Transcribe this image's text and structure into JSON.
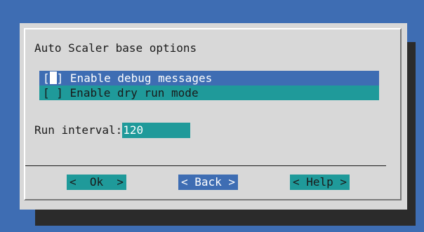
{
  "dialog": {
    "title": "Auto Scaler base options",
    "checklist": [
      {
        "box": "[ ]",
        "label": "Enable debug messages",
        "selected": true
      },
      {
        "box": "[ ]",
        "label": "Enable dry run mode",
        "selected": false
      }
    ],
    "run_interval": {
      "label": "Run interval:",
      "value": "120"
    },
    "buttons": {
      "ok": "<  Ok  >",
      "back": "< Back >",
      "help": "< Help >"
    }
  },
  "colors": {
    "background": "#3e6db3",
    "dialog": "#d8d8d8",
    "teal": "#1f9a9a",
    "shadow": "#2b2b2b"
  }
}
